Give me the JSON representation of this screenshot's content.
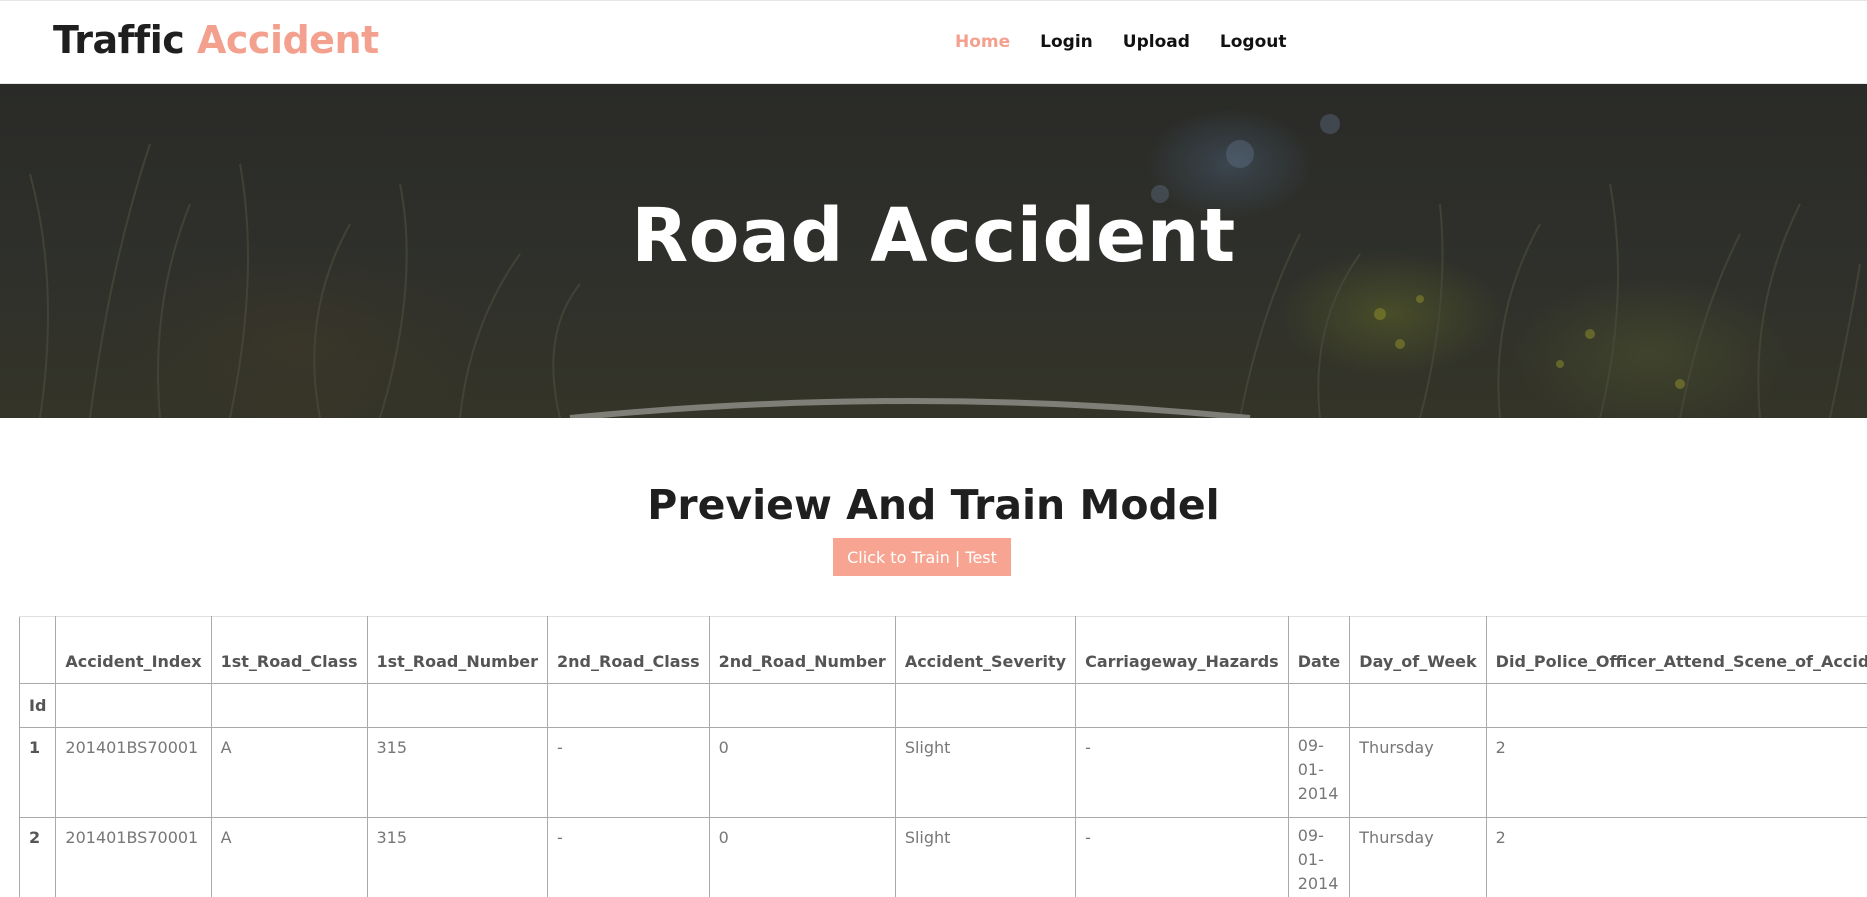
{
  "header": {
    "brand_main": "Traffic",
    "brand_accent": "Accident",
    "nav": [
      "Home",
      "Login",
      "Upload",
      "Logout"
    ],
    "active_nav": "Home"
  },
  "hero": {
    "title": "Road Accident"
  },
  "main": {
    "section_title": "Preview And Train Model",
    "train_button": "Click to Train | Test"
  },
  "table": {
    "columns": [
      "",
      "Accident_Index",
      "1st_Road_Class",
      "1st_Road_Number",
      "2nd_Road_Class",
      "2nd_Road_Number",
      "Accident_Severity",
      "Carriageway_Hazards",
      "Date",
      "Day_of_Week",
      "Did_Police_Officer_Attend_Scene_of_Accident"
    ],
    "index_label": "Id",
    "rows": [
      [
        "1",
        "201401BS70001",
        "A",
        "315",
        "-",
        "0",
        "Slight",
        "-",
        "09-01-2014",
        "Thursday",
        "2"
      ],
      [
        "2",
        "201401BS70001",
        "A",
        "315",
        "-",
        "0",
        "Slight",
        "-",
        "09-01-2014",
        "Thursday",
        "2"
      ]
    ]
  },
  "colors": {
    "accent": "#f4a08e",
    "button": "#f7a592",
    "hero_bg": "#2f302b"
  }
}
